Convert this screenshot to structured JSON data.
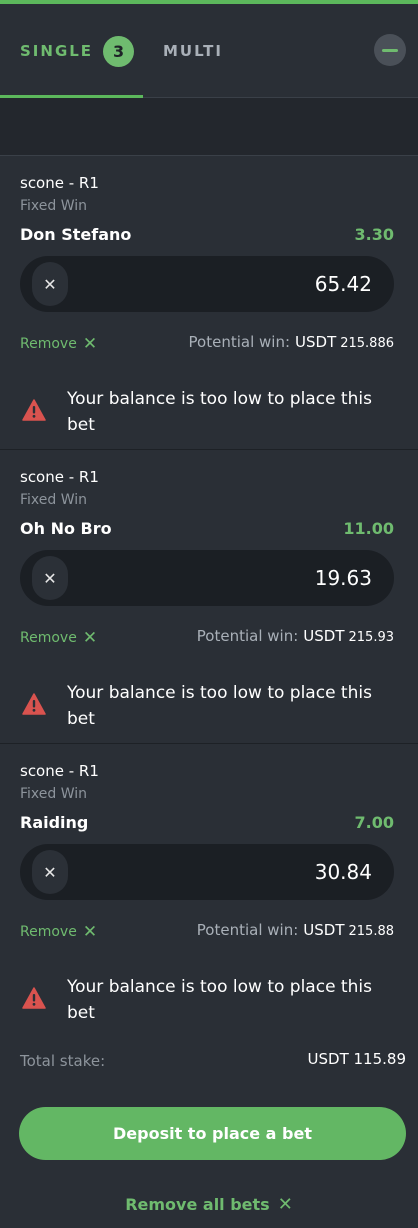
{
  "tabs": {
    "single_label": "SINGLE",
    "single_count": "3",
    "multi_label": "MULTI"
  },
  "bets": [
    {
      "race": "scone - R1",
      "market": "Fixed Win",
      "runner": "Don Stefano",
      "odds": "3.30",
      "stake": "65.42",
      "remove_label": "Remove",
      "potential_label": "Potential win:",
      "currency": "USDT",
      "potential_amount": "215.886",
      "warning": "Your balance is too low to place this bet"
    },
    {
      "race": "scone - R1",
      "market": "Fixed Win",
      "runner": "Oh No Bro",
      "odds": "11.00",
      "stake": "19.63",
      "remove_label": "Remove",
      "potential_label": "Potential win:",
      "currency": "USDT",
      "potential_amount": "215.93",
      "warning": "Your balance is too low to place this bet"
    },
    {
      "race": "scone - R1",
      "market": "Fixed Win",
      "runner": "Raiding",
      "odds": "7.00",
      "stake": "30.84",
      "remove_label": "Remove",
      "potential_label": "Potential win:",
      "currency": "USDT",
      "potential_amount": "215.88",
      "warning": "Your balance is too low to place this bet"
    }
  ],
  "summary": {
    "total_stake_label": "Total stake:",
    "total_stake_value": "USDT 115.89",
    "deposit_button": "Deposit to place a bet",
    "remove_all_label": "Remove all bets"
  },
  "icons": {
    "clear": "close-icon",
    "remove": "close-icon",
    "warning": "warning-triangle-icon",
    "collapse": "minus-icon"
  },
  "colors": {
    "accent": "#63b764",
    "background": "#2a2f36",
    "warning": "#d9534f"
  }
}
